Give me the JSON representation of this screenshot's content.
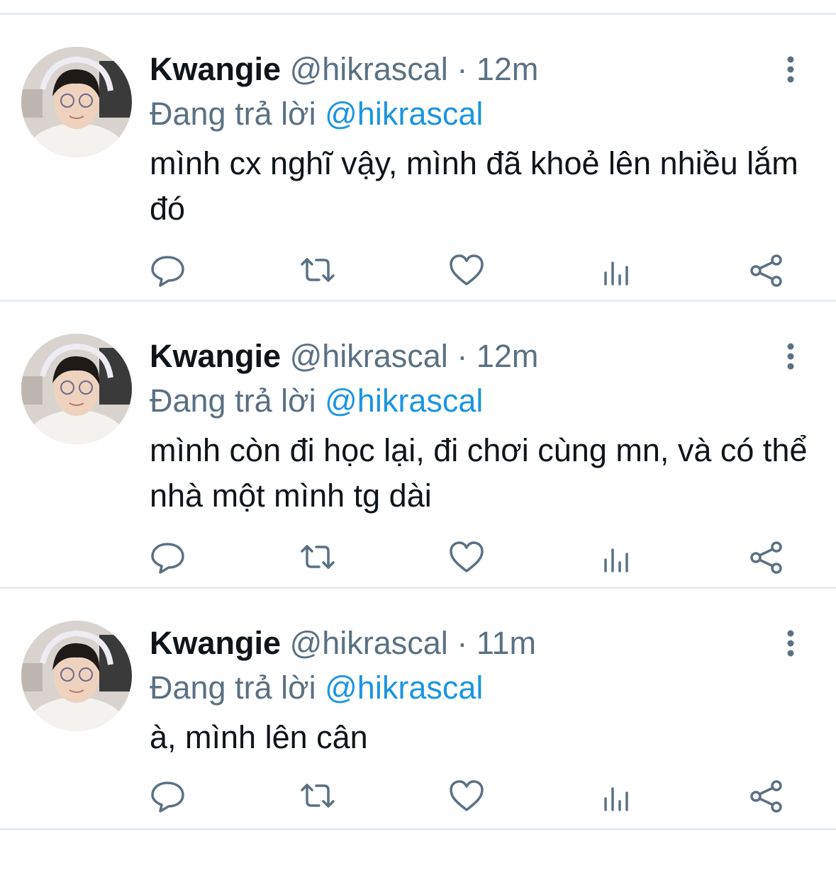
{
  "colors": {
    "name": "#0f1419",
    "meta": "#5b7083",
    "mention": "#1b95e0",
    "divider": "#e6ecf0",
    "icon": "#5b7083"
  },
  "icons": [
    "more-vertical-icon",
    "reply-icon",
    "retweet-icon",
    "like-icon",
    "analytics-icon",
    "share-icon"
  ],
  "tweets": [
    {
      "display_name": "Kwangie",
      "handle": "@hikrascal",
      "separator": "·",
      "time": "12m",
      "reply_prefix": "Đang trả lời",
      "reply_to": "@hikrascal",
      "text": "mình cx nghĩ vậy, mình đã khoẻ lên nhiều lắm đó"
    },
    {
      "display_name": "Kwangie",
      "handle": "@hikrascal",
      "separator": "·",
      "time": "12m",
      "reply_prefix": "Đang trả lời",
      "reply_to": "@hikrascal",
      "text": "mình còn đi học lại, đi chơi cùng mn, và có thể nhà một mình tg dài"
    },
    {
      "display_name": "Kwangie",
      "handle": "@hikrascal",
      "separator": "·",
      "time": "11m",
      "reply_prefix": "Đang trả lời",
      "reply_to": "@hikrascal",
      "text": "à, mình lên cân"
    }
  ]
}
